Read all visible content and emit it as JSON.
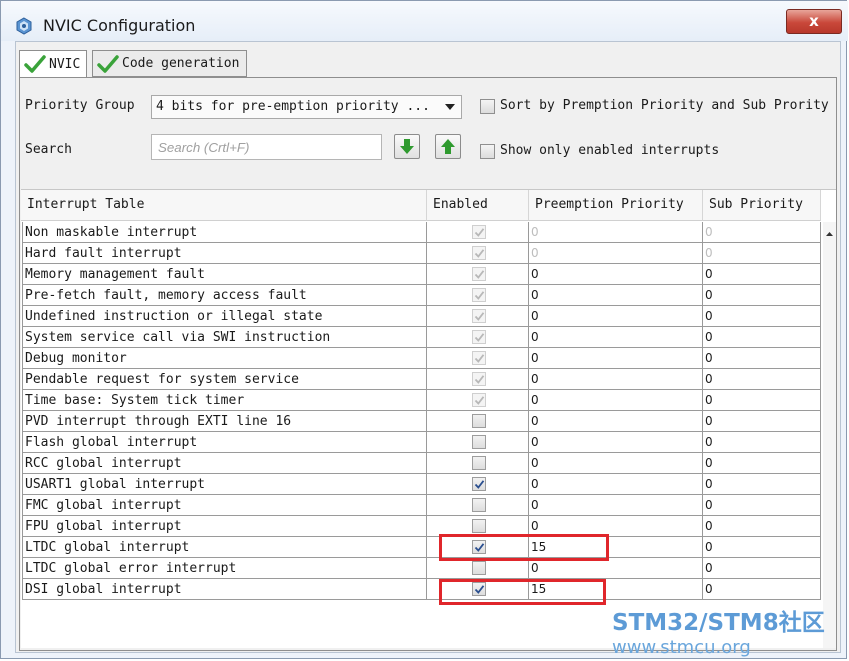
{
  "window": {
    "title": "NVIC Configuration",
    "close_glyph": "x"
  },
  "tabs": [
    {
      "label": "NVIC",
      "active": true
    },
    {
      "label": "Code generation",
      "active": false
    }
  ],
  "priority_group": {
    "label": "Priority Group",
    "value": "4 bits for pre-emption priority ..."
  },
  "sort_option": {
    "label": "Sort by Premption Priority and Sub Prority",
    "checked": false
  },
  "search": {
    "label": "Search",
    "placeholder": "Search (Crtl+F)"
  },
  "show_enabled_option": {
    "label": "Show only enabled interrupts",
    "checked": false
  },
  "table": {
    "headers": [
      "Interrupt Table",
      "Enabled",
      "Preemption Priority",
      "Sub Priority"
    ],
    "rows": [
      {
        "name": "Non maskable interrupt",
        "enabled": true,
        "locked": true,
        "preemption": "0",
        "sub": "0",
        "dim": true
      },
      {
        "name": "Hard fault interrupt",
        "enabled": true,
        "locked": true,
        "preemption": "0",
        "sub": "0",
        "dim": true
      },
      {
        "name": "Memory management fault",
        "enabled": true,
        "locked": true,
        "preemption": "0",
        "sub": "0",
        "dim": false
      },
      {
        "name": "Pre-fetch fault, memory access fault",
        "enabled": true,
        "locked": true,
        "preemption": "0",
        "sub": "0",
        "dim": false
      },
      {
        "name": "Undefined instruction or illegal state",
        "enabled": true,
        "locked": true,
        "preemption": "0",
        "sub": "0",
        "dim": false
      },
      {
        "name": "System service call via SWI instruction",
        "enabled": true,
        "locked": true,
        "preemption": "0",
        "sub": "0",
        "dim": false
      },
      {
        "name": "Debug monitor",
        "enabled": true,
        "locked": true,
        "preemption": "0",
        "sub": "0",
        "dim": false
      },
      {
        "name": "Pendable request for system service",
        "enabled": true,
        "locked": true,
        "preemption": "0",
        "sub": "0",
        "dim": false
      },
      {
        "name": "Time base: System tick timer",
        "enabled": true,
        "locked": true,
        "preemption": "0",
        "sub": "0",
        "dim": false
      },
      {
        "name": "PVD interrupt through EXTI line 16",
        "enabled": false,
        "locked": false,
        "preemption": "0",
        "sub": "0",
        "dim": false
      },
      {
        "name": "Flash global interrupt",
        "enabled": false,
        "locked": false,
        "preemption": "0",
        "sub": "0",
        "dim": false
      },
      {
        "name": "RCC global interrupt",
        "enabled": false,
        "locked": false,
        "preemption": "0",
        "sub": "0",
        "dim": false
      },
      {
        "name": "USART1 global interrupt",
        "enabled": true,
        "locked": false,
        "preemption": "0",
        "sub": "0",
        "dim": false
      },
      {
        "name": "FMC global interrupt",
        "enabled": false,
        "locked": false,
        "preemption": "0",
        "sub": "0",
        "dim": false
      },
      {
        "name": "FPU global interrupt",
        "enabled": false,
        "locked": false,
        "preemption": "0",
        "sub": "0",
        "dim": false
      },
      {
        "name": "LTDC global interrupt",
        "enabled": true,
        "locked": false,
        "preemption": "15",
        "sub": "0",
        "dim": false
      },
      {
        "name": "LTDC global error interrupt",
        "enabled": false,
        "locked": false,
        "preemption": "0",
        "sub": "0",
        "dim": false
      },
      {
        "name": "DSI global interrupt",
        "enabled": true,
        "locked": false,
        "preemption": "15",
        "sub": "0",
        "dim": false
      }
    ]
  },
  "watermark": {
    "line1": "STM32/STM8社区",
    "line2": "www.stmcu.org"
  },
  "colors": {
    "highlight": "#e0262b",
    "check_green": "#3aa33a",
    "watermark": "#5d9bd6"
  }
}
